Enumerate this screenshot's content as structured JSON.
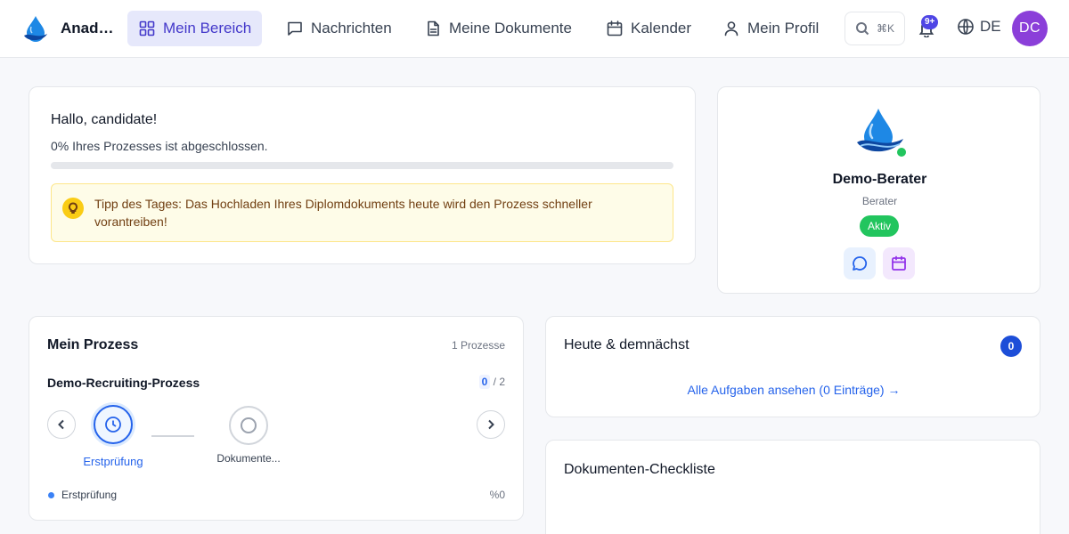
{
  "header": {
    "brand": "Anadolu Tourism",
    "nav": [
      {
        "label": "Mein Bereich",
        "icon": "grid-icon",
        "active": true
      },
      {
        "label": "Nachrichten",
        "icon": "chat-icon"
      },
      {
        "label": "Meine Dokumente",
        "icon": "document-icon"
      },
      {
        "label": "Kalender",
        "icon": "calendar-icon"
      },
      {
        "label": "Mein Profil",
        "icon": "user-icon"
      }
    ],
    "search_shortcut": "⌘K",
    "notification_count": "9+",
    "language": "DE",
    "avatar_initials": "DC"
  },
  "welcome": {
    "greeting": "Hallo, candidate!",
    "progress_text": "0% Ihres Prozesses ist abgeschlossen.",
    "progress_percent": 0,
    "tip": "Tipp des Tages: Das Hochladen Ihres Diplomdokuments heute wird den Prozess schneller vorantreiben!"
  },
  "advisor": {
    "name": "Demo-Berater",
    "role": "Berater",
    "status": "Aktiv"
  },
  "process": {
    "title": "Mein Prozess",
    "count": "1 Prozesse",
    "name": "Demo-Recruiting-Prozess",
    "current_step": "0",
    "total_steps": "/ 2",
    "steps": [
      {
        "label": "Erstprüfung",
        "state": "active"
      },
      {
        "label": "Dokumente...",
        "state": "pending"
      }
    ],
    "legend_label": "Erstprüfung",
    "legend_value": "%0"
  },
  "today": {
    "title": "Heute & demnächst",
    "count": "0",
    "link": "Alle Aufgaben ansehen (0 Einträge) →"
  },
  "checklist": {
    "title": "Dokumenten-Checkliste"
  },
  "colors": {
    "accent": "#4f46e5",
    "active_nav_bg": "#e6e8fb",
    "status_green": "#22c55e",
    "link_blue": "#2563eb",
    "avatar_purple": "#8b3fd9"
  }
}
